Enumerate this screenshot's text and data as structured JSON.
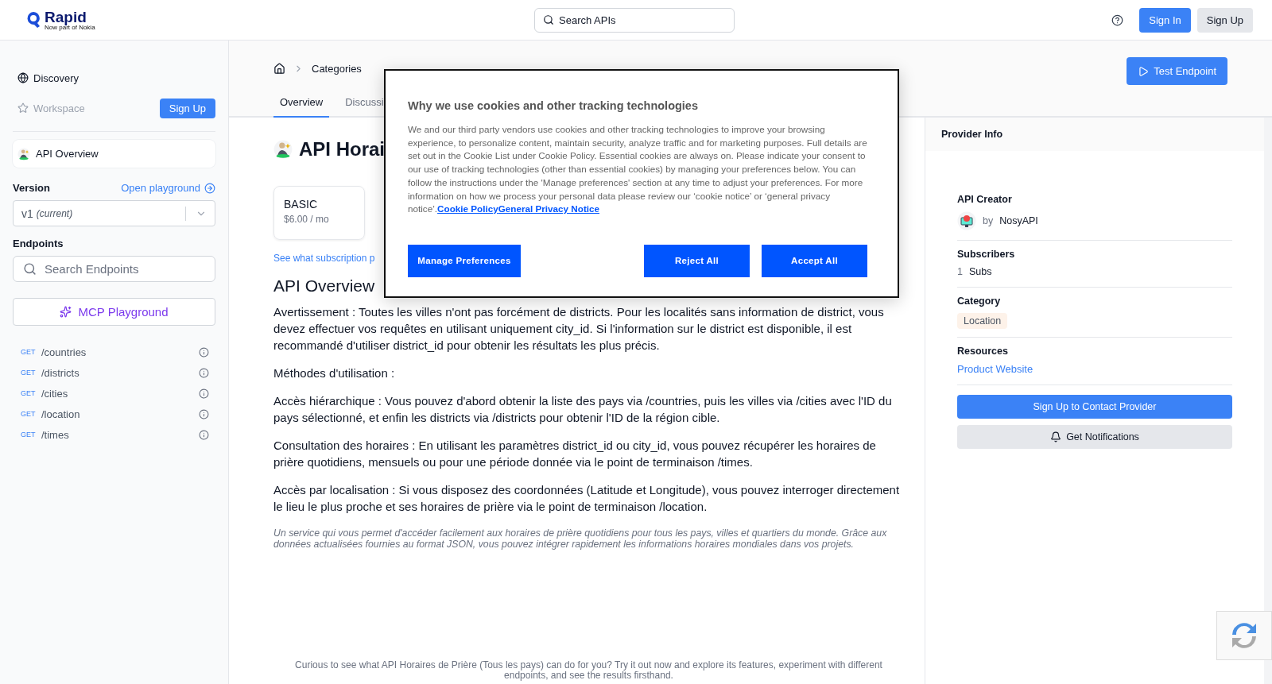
{
  "header": {
    "logo": {
      "name": "Rapid",
      "tagline": "Now part of Nokia"
    },
    "search": {
      "placeholder": "Search APIs"
    },
    "buttons": [
      {
        "label": "Sign In",
        "kind": "primary"
      },
      {
        "label": "Sign Up",
        "kind": "secondary"
      }
    ]
  },
  "sidebar": {
    "nav": [
      {
        "label": "Discovery",
        "disabled": false
      },
      {
        "label": "Workspace",
        "disabled": true
      }
    ],
    "workspace_button": "Sign Up",
    "api_overview": {
      "label": "API Overview",
      "selected": true
    },
    "version": {
      "label": "Version",
      "link": "Open playground",
      "value": "v1",
      "note": "(current)"
    },
    "endpoints": {
      "label": "Endpoints",
      "placeholder": "Search Endpoints",
      "mcp_button": "MCP Playground",
      "items": [
        {
          "method": "GET",
          "path": "/countries"
        },
        {
          "method": "GET",
          "path": "/districts"
        },
        {
          "method": "GET",
          "path": "/cities"
        },
        {
          "method": "GET",
          "path": "/location"
        },
        {
          "method": "GET",
          "path": "/times"
        }
      ]
    }
  },
  "main": {
    "breadcrumb": [
      "Categories"
    ],
    "tabs": [
      {
        "label": "Overview",
        "selected": true
      },
      {
        "label": "Discussi",
        "selected": false
      }
    ],
    "test_button": "Test Endpoint",
    "title": "API Horai",
    "plans": [
      {
        "name": "BASIC",
        "price": "$6.00 / mo"
      }
    ],
    "subscription_link": "See what subscription p",
    "overview": {
      "heading": "API Overview",
      "paragraphs": [
        "Avertissement : Toutes les villes n'ont pas forcément de districts. Pour les localités sans information de district, vous devez effectuer vos requêtes en utilisant uniquement city_id. Si l'information sur le district est disponible, il est recommandé d'utiliser district_id pour obtenir les résultats les plus précis.",
        "Méthodes d'utilisation :",
        "Accès hiérarchique : Vous pouvez d'abord obtenir la liste des pays via /countries, puis les villes via /cities avec l'ID du pays sélectionné, et enfin les districts via /districts pour obtenir l'ID de la région cible.",
        "Consultation des horaires : En utilisant les paramètres district_id ou city_id, vous pouvez récupérer les horaires de prière quotidiens, mensuels ou pour une période donnée via le point de terminaison /times.",
        "Accès par localisation : Si vous disposez des coordonnées (Latitude et Longitude), vous pouvez interroger directement le lieu le plus proche et ses horaires de prière via le point de terminaison /location."
      ],
      "description": "Un service qui vous permet d'accéder facilement aux horaires de prière quotidiens pour tous les pays, villes et quartiers du monde. Grâce aux données actualisées fournies au format JSON, vous pouvez intégrer rapidement les informations horaires mondiales dans vos projets."
    },
    "cta": "Curious to see what API Horaires de Prière (Tous les pays) can do for you? Try it out now and explore its features, experiment with different endpoints, and see the results firsthand."
  },
  "provider": {
    "header": "Provider Info",
    "creator": {
      "label": "API Creator",
      "by": "by",
      "name": "NosyAPI"
    },
    "subscribers": {
      "label": "Subscribers",
      "count": "1",
      "unit": "Subs"
    },
    "category": {
      "label": "Category",
      "tag": "Location"
    },
    "resources": {
      "label": "Resources",
      "link": "Product Website"
    },
    "contact_button": "Sign Up to Contact Provider",
    "notify_button": "Get Notifications"
  },
  "cookie_dialog": {
    "title": "Why we use cookies and other tracking technologies",
    "body": "We and our third party vendors use cookies and other tracking technologies to improve your browsing experience, to personalize content, maintain security, analyze traffic and for marketing purposes. Full details are set out in the Cookie List under Cookie Policy. Essential cookies are always on. Please indicate your consent to our use of tracking technologies (other than essential cookies) by managing your preferences below. You can follow the instructions under the 'Manage preferences' section at any time to adjust your preferences. For more information on how we process your personal data please review our ‘cookie notice’ or ‘general privacy notice’.",
    "links": [
      "Cookie Policy",
      "General Privacy Notice"
    ],
    "buttons": [
      "Manage Preferences",
      "Reject All",
      "Accept All"
    ]
  }
}
